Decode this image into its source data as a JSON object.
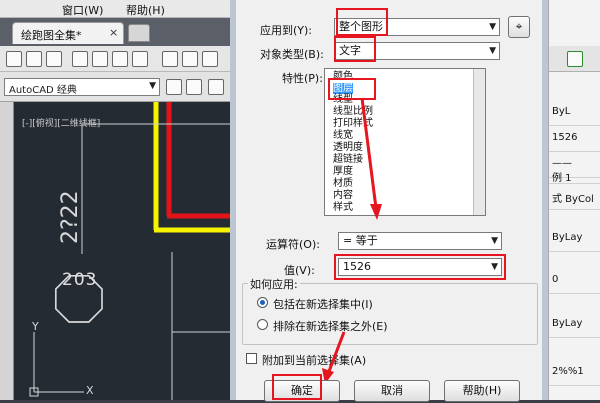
{
  "menubar": {
    "items": [
      "窗口(W)",
      "帮助(H)"
    ]
  },
  "tabs": {
    "doc_tab_label": "绘跑图全集*",
    "close_glyph": "×"
  },
  "toolbar": {
    "workspace_value": "AutoCAD 经典"
  },
  "viewport": {
    "label": "[-][俯视][二维线框]",
    "dim_text": "2?22",
    "tag_text": "203",
    "axis_y": "Y",
    "axis_x": "X"
  },
  "dialog": {
    "apply_to_label": "应用到(Y):",
    "apply_to_value": "整个图形",
    "object_type_label": "对象类型(B):",
    "object_type_value": "文字",
    "properties_label": "特性(P):",
    "properties": [
      "颜色",
      "图层",
      "线型",
      "线型比例",
      "打印样式",
      "线宽",
      "透明度",
      "超链接",
      "厚度",
      "材质",
      "内容",
      "样式"
    ],
    "selected_property_index": 1,
    "operator_label": "运算符(O):",
    "operator_value": "= 等于",
    "value_label": "值(V):",
    "value_value": "1526",
    "how_apply_label": "如何应用:",
    "radio_include": "包括在新选择集中(I)",
    "radio_exclude": "排除在新选择集之外(E)",
    "append_label": "附加到当前选择集(A)",
    "ok_button": "确定",
    "cancel_button": "取消",
    "help_button": "帮助(H)"
  },
  "right_panel": {
    "rows": [
      "ByL",
      "1526",
      "——",
      "例 1",
      "式 ByCol",
      "",
      "ByLay",
      "",
      "0",
      "",
      "ByLay",
      "",
      "2%%1",
      ""
    ]
  },
  "colors": {
    "highlight": "#e5161f",
    "selection": "#3399ff",
    "canvas": "#252b33",
    "yellow_line": "#f4f400",
    "red_line": "#e2141a"
  }
}
